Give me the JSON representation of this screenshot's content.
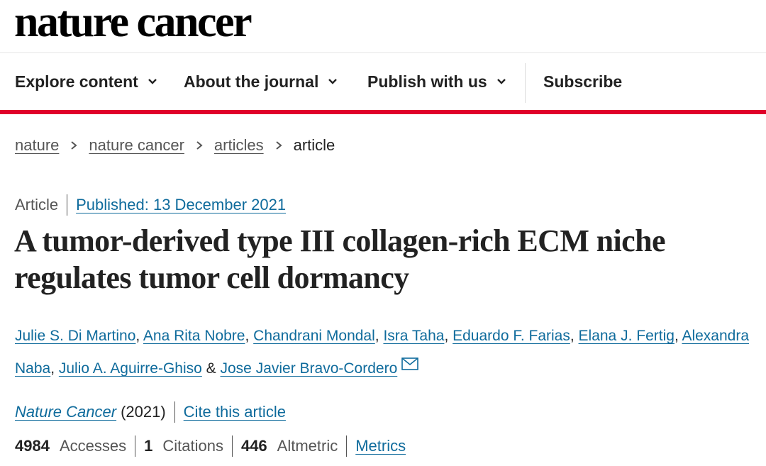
{
  "logo": {
    "text": "nature cancer"
  },
  "nav": {
    "items": [
      {
        "label": "Explore content",
        "has_dropdown": true
      },
      {
        "label": "About the journal",
        "has_dropdown": true
      },
      {
        "label": "Publish with us",
        "has_dropdown": true
      }
    ],
    "subscribe_label": "Subscribe"
  },
  "colors": {
    "accent_red": "#e0002b",
    "link_blue": "#0f6b9c"
  },
  "breadcrumb": {
    "items": [
      "nature",
      "nature cancer",
      "articles"
    ],
    "current": "article"
  },
  "article": {
    "type": "Article",
    "published": "Published: 13 December 2021",
    "title": "A tumor-derived type III collagen-rich ECM niche regulates tumor cell dormancy",
    "authors": [
      "Julie S. Di Martino",
      "Ana Rita Nobre",
      "Chandrani Mondal",
      "Isra Taha",
      "Eduardo F. Farias",
      "Elana J. Fertig",
      "Alexandra Naba",
      "Julio A. Aguirre-Ghiso",
      "Jose Javier Bravo-Cordero"
    ],
    "author_separator": ", ",
    "author_and": " & ",
    "corresponding_icon": "mail-icon",
    "journal": "Nature Cancer",
    "year": "(2021)",
    "cite_label": "Cite this article"
  },
  "metrics": {
    "accesses_value": "4984",
    "accesses_label": "Accesses",
    "citations_value": "1",
    "citations_label": "Citations",
    "altmetric_value": "446",
    "altmetric_label": "Altmetric",
    "metrics_link": "Metrics"
  }
}
